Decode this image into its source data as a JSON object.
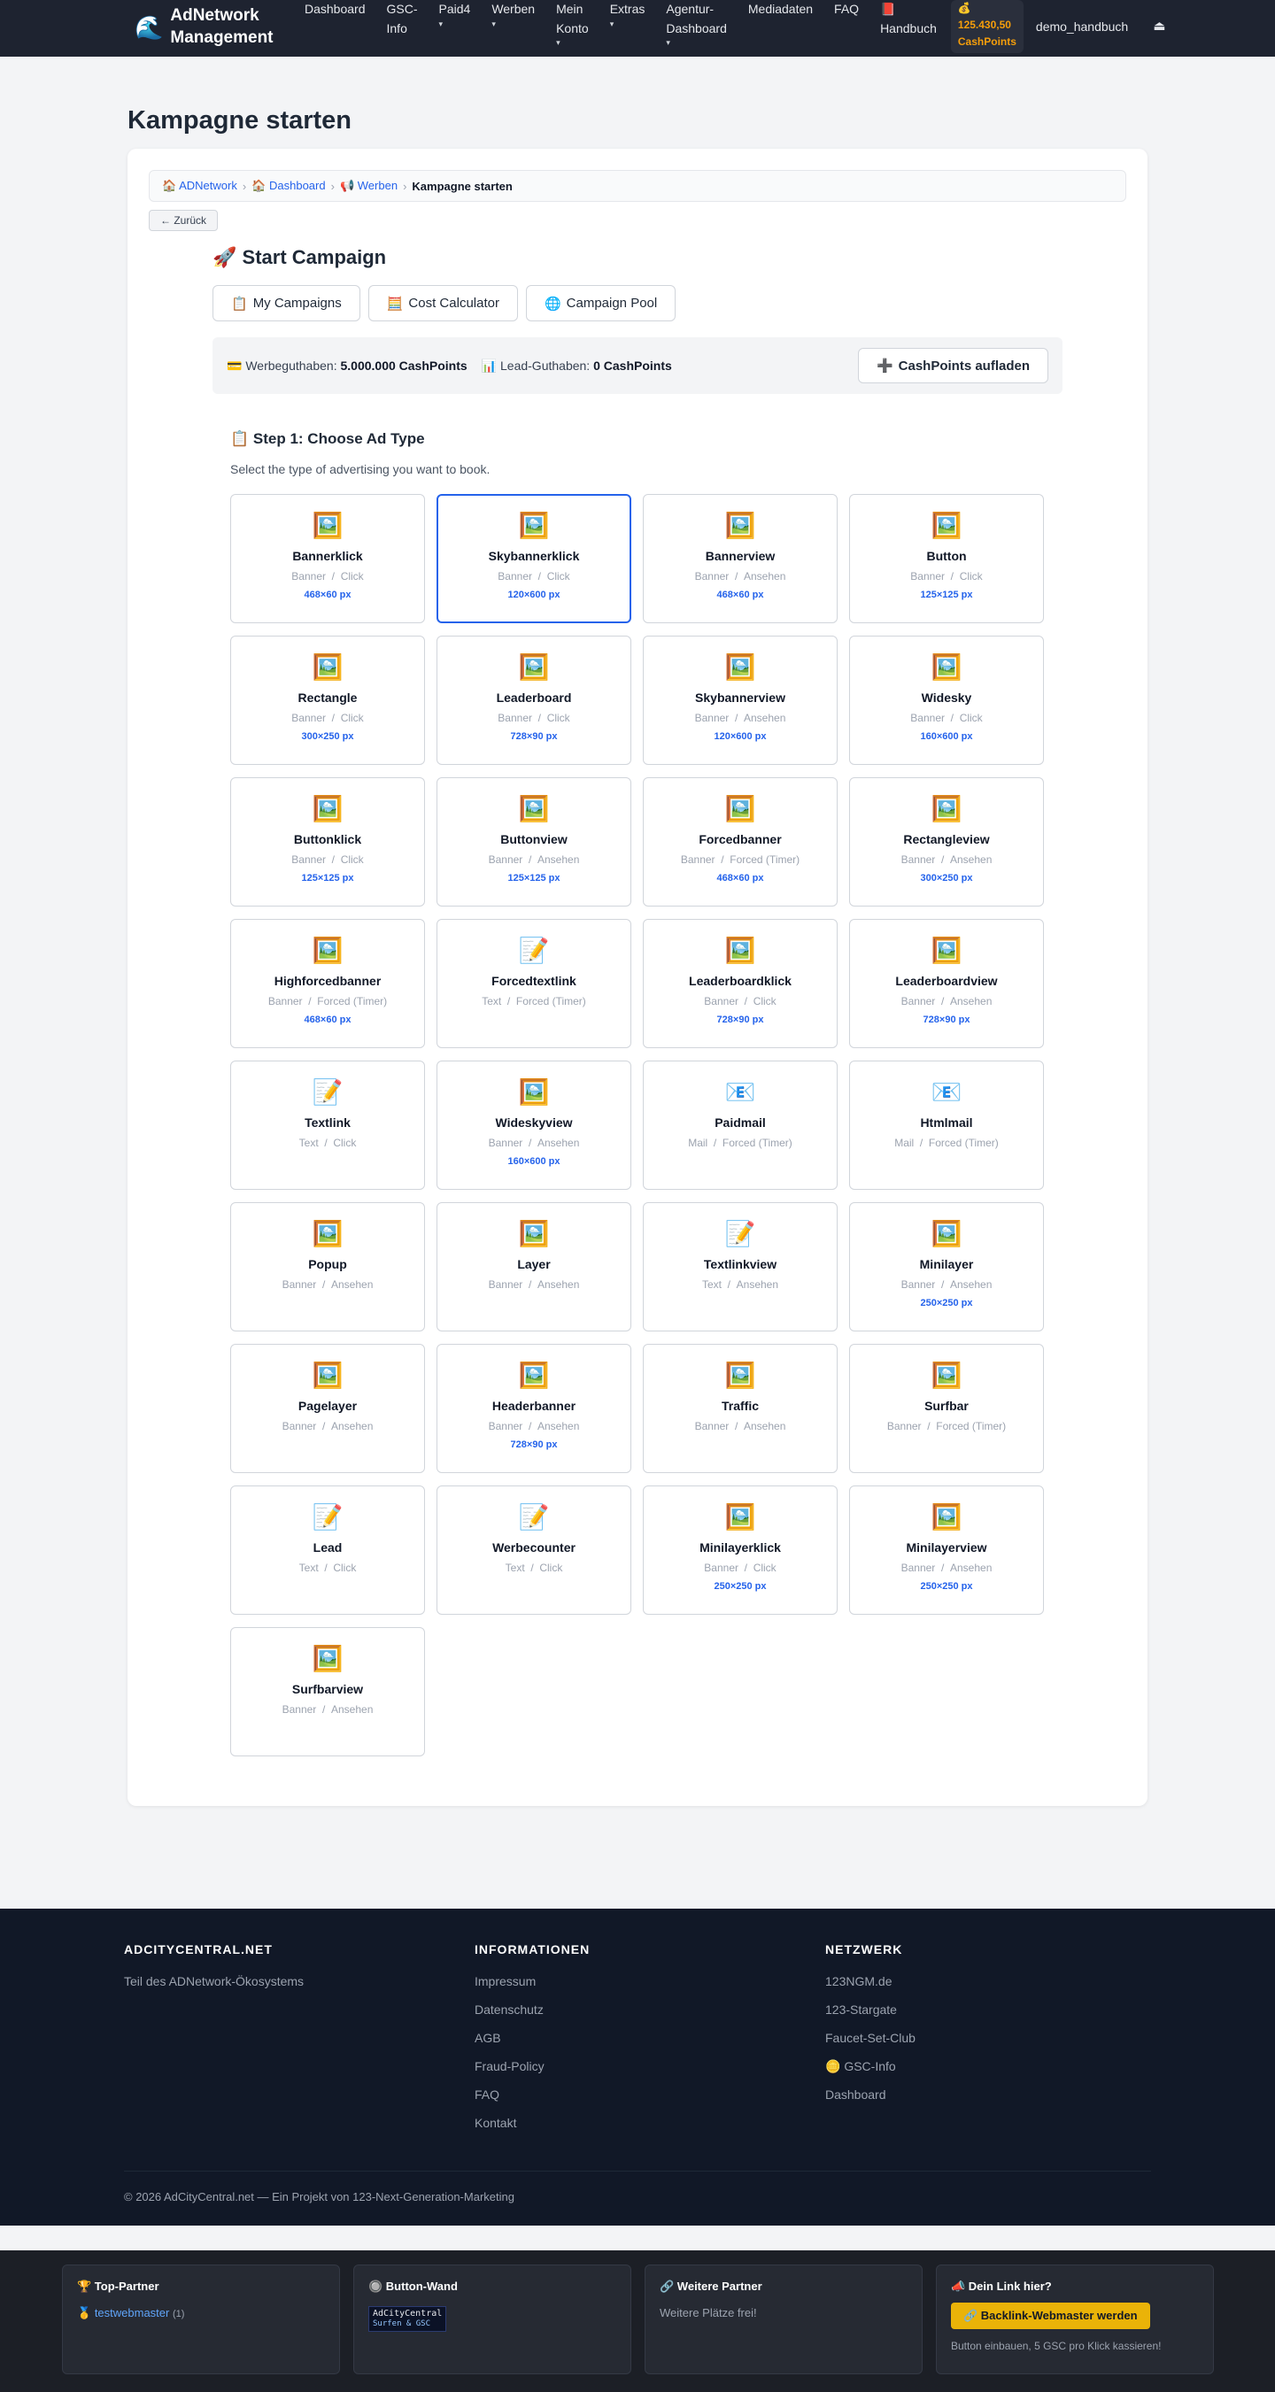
{
  "nav": {
    "brand_icon": "🌊",
    "brand_line1": "AdNetwork",
    "brand_line2": "Management",
    "items": [
      {
        "label1": "Dashboard",
        "label2": "",
        "caret": false
      },
      {
        "label1": "GSC-",
        "label2": "Info",
        "caret": false
      },
      {
        "label1": "Paid4",
        "label2": "",
        "caret": true
      },
      {
        "label1": "Werben",
        "label2": "",
        "caret": true
      },
      {
        "label1": "Mein",
        "label2": "Konto",
        "caret": true
      },
      {
        "label1": "Extras",
        "label2": "",
        "caret": true
      },
      {
        "label1": "Agentur-",
        "label2": "Dashboard",
        "caret": true
      },
      {
        "label1": "Mediadaten",
        "label2": "",
        "caret": false
      },
      {
        "label1": "FAQ",
        "label2": "",
        "caret": false
      }
    ],
    "handbook_icon": "📕",
    "handbook_label": "Handbuch",
    "cash_icon": "💰",
    "cash_amount": "125.430,50",
    "cash_unit": "CashPoints",
    "username": "demo_handbuch",
    "logout_icon": "⏏",
    "caret_glyph": "▾"
  },
  "page": {
    "title": "Kampagne starten"
  },
  "breadcrumb": {
    "items": [
      {
        "icon": "🏠",
        "label": "ADNetwork"
      },
      {
        "icon": "🏠",
        "label": "Dashboard"
      },
      {
        "icon": "📢",
        "label": "Werben"
      }
    ],
    "current": "Kampagne starten",
    "separator": "›"
  },
  "back_button": "← Zurück",
  "campaign": {
    "title_icon": "🚀",
    "title": "Start Campaign",
    "tabs": [
      {
        "icon": "📋",
        "label": "My Campaigns"
      },
      {
        "icon": "🧮",
        "label": "Cost Calculator"
      },
      {
        "icon": "🌐",
        "label": "Campaign Pool"
      }
    ],
    "balance": {
      "ad_icon": "💳",
      "ad_label": "Werbeguthaben:",
      "ad_value": "5.000.000 CashPoints",
      "lead_icon": "📊",
      "lead_label": "Lead-Guthaben:",
      "lead_value": "0 CashPoints",
      "topup_icon": "➕",
      "topup_label": "CashPoints aufladen"
    },
    "step_icon": "📋",
    "step_title": "Step 1: Choose Ad Type",
    "step_subtitle": "Select the type of advertising you want to book.",
    "meta_separator": "/",
    "ad_types": [
      {
        "icon": "🖼️",
        "name": "Bannerklick",
        "kind": "Banner",
        "action": "Click",
        "size": "468×60 px",
        "selected": false
      },
      {
        "icon": "🖼️",
        "name": "Skybannerklick",
        "kind": "Banner",
        "action": "Click",
        "size": "120×600 px",
        "selected": true
      },
      {
        "icon": "🖼️",
        "name": "Bannerview",
        "kind": "Banner",
        "action": "Ansehen",
        "size": "468×60 px",
        "selected": false
      },
      {
        "icon": "🖼️",
        "name": "Button",
        "kind": "Banner",
        "action": "Click",
        "size": "125×125 px",
        "selected": false
      },
      {
        "icon": "🖼️",
        "name": "Rectangle",
        "kind": "Banner",
        "action": "Click",
        "size": "300×250 px",
        "selected": false
      },
      {
        "icon": "🖼️",
        "name": "Leaderboard",
        "kind": "Banner",
        "action": "Click",
        "size": "728×90 px",
        "selected": false
      },
      {
        "icon": "🖼️",
        "name": "Skybannerview",
        "kind": "Banner",
        "action": "Ansehen",
        "size": "120×600 px",
        "selected": false
      },
      {
        "icon": "🖼️",
        "name": "Widesky",
        "kind": "Banner",
        "action": "Click",
        "size": "160×600 px",
        "selected": false
      },
      {
        "icon": "🖼️",
        "name": "Buttonklick",
        "kind": "Banner",
        "action": "Click",
        "size": "125×125 px",
        "selected": false
      },
      {
        "icon": "🖼️",
        "name": "Buttonview",
        "kind": "Banner",
        "action": "Ansehen",
        "size": "125×125 px",
        "selected": false
      },
      {
        "icon": "🖼️",
        "name": "Forcedbanner",
        "kind": "Banner",
        "action": "Forced (Timer)",
        "size": "468×60 px",
        "selected": false
      },
      {
        "icon": "🖼️",
        "name": "Rectangleview",
        "kind": "Banner",
        "action": "Ansehen",
        "size": "300×250 px",
        "selected": false
      },
      {
        "icon": "🖼️",
        "name": "Highforcedbanner",
        "kind": "Banner",
        "action": "Forced (Timer)",
        "size": "468×60 px",
        "selected": false
      },
      {
        "icon": "📝",
        "name": "Forcedtextlink",
        "kind": "Text",
        "action": "Forced (Timer)",
        "size": "",
        "selected": false
      },
      {
        "icon": "🖼️",
        "name": "Leaderboardklick",
        "kind": "Banner",
        "action": "Click",
        "size": "728×90 px",
        "selected": false
      },
      {
        "icon": "🖼️",
        "name": "Leaderboardview",
        "kind": "Banner",
        "action": "Ansehen",
        "size": "728×90 px",
        "selected": false
      },
      {
        "icon": "📝",
        "name": "Textlink",
        "kind": "Text",
        "action": "Click",
        "size": "",
        "selected": false
      },
      {
        "icon": "🖼️",
        "name": "Wideskyview",
        "kind": "Banner",
        "action": "Ansehen",
        "size": "160×600 px",
        "selected": false
      },
      {
        "icon": "📧",
        "name": "Paidmail",
        "kind": "Mail",
        "action": "Forced (Timer)",
        "size": "",
        "selected": false
      },
      {
        "icon": "📧",
        "name": "Htmlmail",
        "kind": "Mail",
        "action": "Forced (Timer)",
        "size": "",
        "selected": false
      },
      {
        "icon": "🖼️",
        "name": "Popup",
        "kind": "Banner",
        "action": "Ansehen",
        "size": "",
        "selected": false
      },
      {
        "icon": "🖼️",
        "name": "Layer",
        "kind": "Banner",
        "action": "Ansehen",
        "size": "",
        "selected": false
      },
      {
        "icon": "📝",
        "name": "Textlinkview",
        "kind": "Text",
        "action": "Ansehen",
        "size": "",
        "selected": false
      },
      {
        "icon": "🖼️",
        "name": "Minilayer",
        "kind": "Banner",
        "action": "Ansehen",
        "size": "250×250 px",
        "selected": false
      },
      {
        "icon": "🖼️",
        "name": "Pagelayer",
        "kind": "Banner",
        "action": "Ansehen",
        "size": "",
        "selected": false
      },
      {
        "icon": "🖼️",
        "name": "Headerbanner",
        "kind": "Banner",
        "action": "Ansehen",
        "size": "728×90 px",
        "selected": false
      },
      {
        "icon": "🖼️",
        "name": "Traffic",
        "kind": "Banner",
        "action": "Ansehen",
        "size": "",
        "selected": false
      },
      {
        "icon": "🖼️",
        "name": "Surfbar",
        "kind": "Banner",
        "action": "Forced (Timer)",
        "size": "",
        "selected": false
      },
      {
        "icon": "📝",
        "name": "Lead",
        "kind": "Text",
        "action": "Click",
        "size": "",
        "selected": false
      },
      {
        "icon": "📝",
        "name": "Werbecounter",
        "kind": "Text",
        "action": "Click",
        "size": "",
        "selected": false
      },
      {
        "icon": "🖼️",
        "name": "Minilayerklick",
        "kind": "Banner",
        "action": "Click",
        "size": "250×250 px",
        "selected": false
      },
      {
        "icon": "🖼️",
        "name": "Minilayerview",
        "kind": "Banner",
        "action": "Ansehen",
        "size": "250×250 px",
        "selected": false
      },
      {
        "icon": "🖼️",
        "name": "Surfbarview",
        "kind": "Banner",
        "action": "Ansehen",
        "size": "",
        "selected": false
      }
    ]
  },
  "footer": {
    "col1": {
      "head": "ADCITYCENTRAL.NET",
      "text": "Teil des ADNetwork-Ökosystems"
    },
    "col2": {
      "head": "INFORMATIONEN",
      "links": [
        "Impressum",
        "Datenschutz",
        "AGB",
        "Fraud-Policy",
        "FAQ",
        "Kontakt"
      ]
    },
    "col3": {
      "head": "NETZWERK",
      "links": [
        "123NGM.de",
        "123-Stargate",
        "Faucet-Set-Club",
        "🪙 GSC-Info",
        "Dashboard"
      ]
    },
    "copyright": "© 2026 AdCityCentral.net — Ein Projekt von 123-Next-Generation-Marketing"
  },
  "partners": {
    "top": {
      "head": "🏆 Top-Partner",
      "medal": "🥇",
      "name": "testwebmaster",
      "count": "(1)"
    },
    "wall": {
      "head": "🔘 Button-Wand",
      "banner_line1": "AdCityCentral",
      "banner_line2": "Surfen & GSC"
    },
    "more": {
      "head": "🔗 Weitere Partner",
      "text": "Weitere Plätze frei!"
    },
    "yours": {
      "head": "📣 Dein Link hier?",
      "button": "🔗 Backlink-Webmaster werden",
      "note": "Button einbauen, 5 GSC pro Klick kassieren!"
    }
  }
}
